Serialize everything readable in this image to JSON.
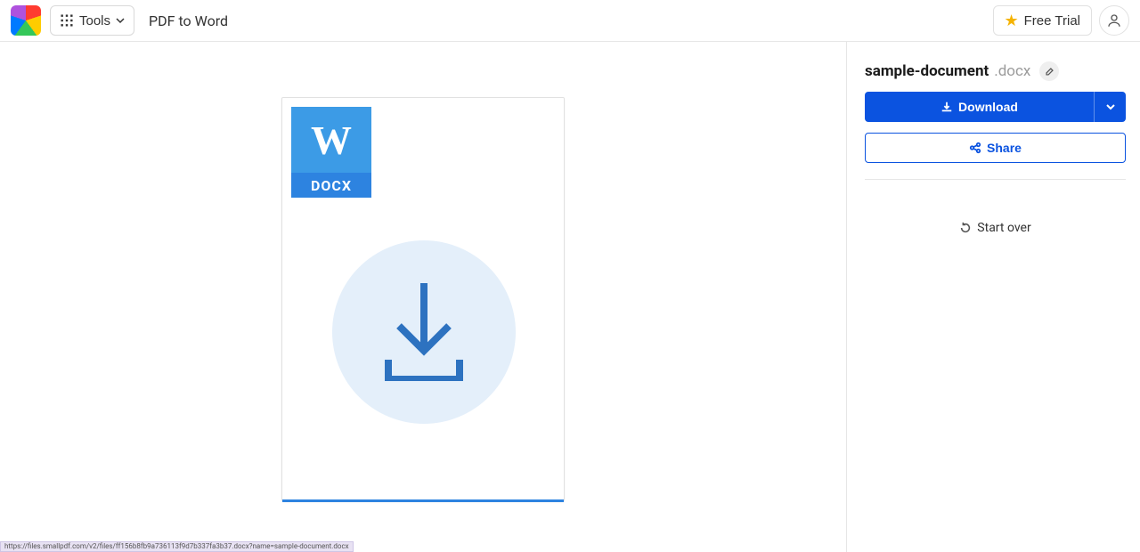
{
  "header": {
    "tools_label": "Tools",
    "page_title": "PDF to Word",
    "free_trial_label": "Free Trial"
  },
  "preview": {
    "doc_letter": "W",
    "doc_badge": "DOCX"
  },
  "side": {
    "filename": "sample-document",
    "fileext": ".docx",
    "download_label": "Download",
    "share_label": "Share",
    "start_over_label": "Start over"
  },
  "statusbar_url": "https://files.smallpdf.com/v2/files/ff156b8fb9a736113f9d7b337fa3b37.docx?name=sample-document.docx"
}
